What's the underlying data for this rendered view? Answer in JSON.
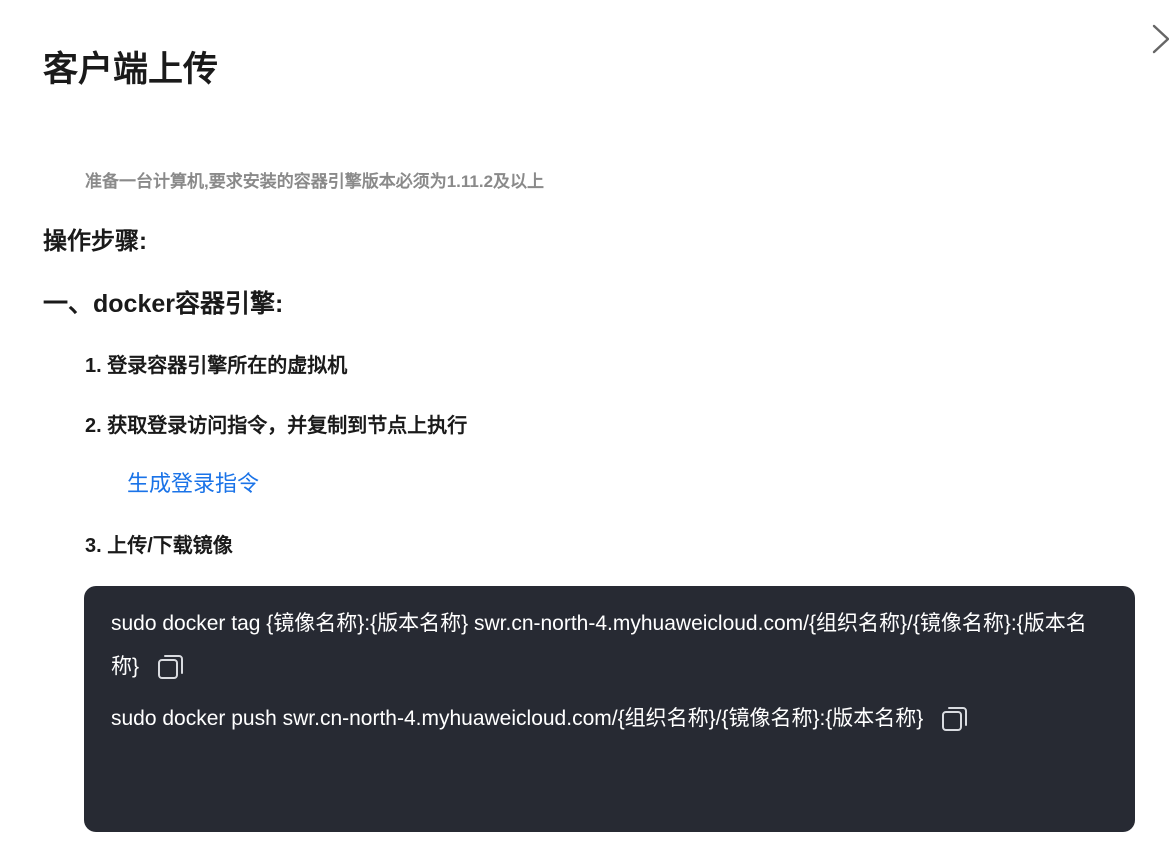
{
  "dialog": {
    "title": "客户端上传",
    "close_icon": "close-icon"
  },
  "prerequisite": "准备一台计算机,要求安装的容器引擎版本必须为1.11.2及以上",
  "steps_heading": "操作步骤:",
  "docker_heading": "一、docker容器引擎:",
  "steps": [
    {
      "label": "1. 登录容器引擎所在的虚拟机"
    },
    {
      "label": "2. 获取登录访问指令，并复制到节点上执行"
    },
    {
      "label": "3. 上传/下载镜像"
    }
  ],
  "generate_link": "生成登录指令",
  "commands": [
    {
      "text": "sudo docker tag {镜像名称}:{版本名称} swr.cn-north-4.myhuaweicloud.com/{组织名称}/{镜像名称}:{版本名称}",
      "copy_icon": "copy-icon"
    },
    {
      "text": "sudo docker push swr.cn-north-4.myhuaweicloud.com/{组织名称}/{镜像名称}:{版本名称}",
      "copy_icon": "copy-icon"
    }
  ],
  "colors": {
    "link": "#1a73e8",
    "code_background": "#272a33",
    "muted_text": "#8a8a8a"
  }
}
